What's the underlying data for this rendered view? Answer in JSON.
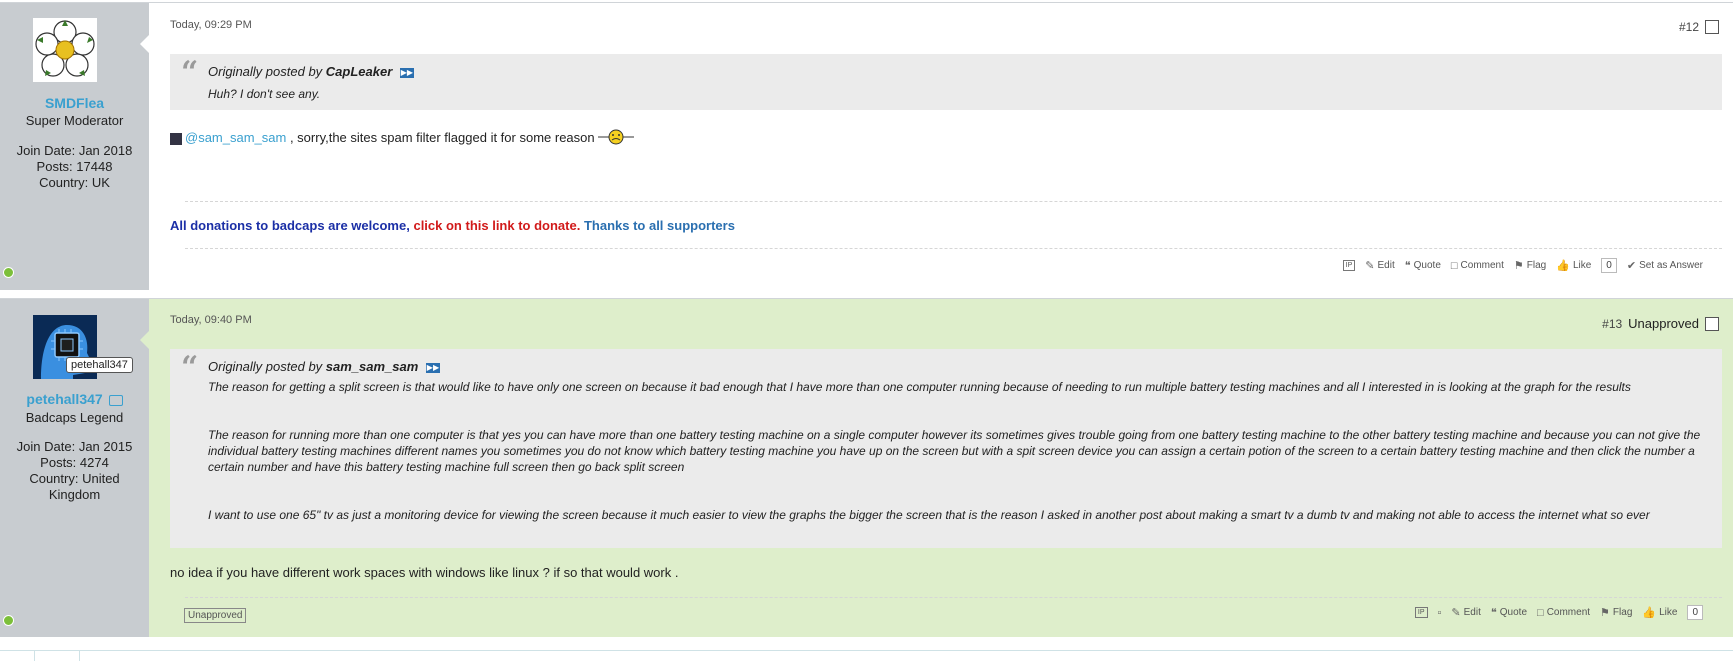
{
  "posts": [
    {
      "user": {
        "name": "SMDFlea",
        "title": "Super Moderator",
        "join_date": "Join Date: Jan 2018",
        "posts": "Posts: 17448",
        "country": "Country: UK"
      },
      "date": "Today, 09:29 PM",
      "number": "#12",
      "quote": {
        "prefix": "Originally posted by",
        "author": "CapLeaker",
        "text": "Huh? I don't see any."
      },
      "mention": "@sam_sam_sam",
      "message": " , sorry,the sites spam filter flagged it for some reason",
      "signature": {
        "part1": "All donations to badcaps are welcome,",
        "part2": "click on this link to donate.",
        "part3": "Thanks to all supporters"
      },
      "actions": {
        "ip": "IP",
        "edit": "Edit",
        "quote": "Quote",
        "comment": "Comment",
        "flag": "Flag",
        "like": "Like",
        "like_count": "0",
        "set_answer": "Set as Answer"
      }
    },
    {
      "user": {
        "name": "petehall347",
        "title": "Badcaps Legend",
        "join_date": "Join Date: Jan 2015",
        "posts": "Posts: 4274",
        "country_line1": "Country: United",
        "country_line2": "Kingdom",
        "tooltip": "petehall347"
      },
      "date": "Today, 09:40 PM",
      "number": "#13",
      "status": "Unapproved",
      "quote": {
        "prefix": "Originally posted by",
        "author": "sam_sam_sam",
        "p1": "The reason for getting a split screen is that would like to have only one screen on because it bad enough that I have more than one computer running because of needing to run multiple battery testing machines and all I interested in is looking at the graph for the results",
        "p2": "The reason for running more than one computer is that yes you can have more than one battery testing machine on a single computer however its sometimes gives trouble going from one battery testing machine to the other battery testing machine and because you can not give the individual battery testing machines different names you sometimes you do not know which battery testing machine you have up on the screen but with a spit screen device you can assign a certain potion of the screen to a certain battery testing machine and then click the number a certain number and have this battery testing machine full screen then go back split screen",
        "p3": "I want to use one 65\" tv as just a monitoring device for viewing the screen because it much easier to view the graphs the bigger the screen that is the reason I asked in another post about making a smart tv a dumb tv and making not able to access the internet what so ever"
      },
      "message": "no idea if you have different work spaces with windows like linux ? if so that would work .",
      "badge": "Unapproved",
      "actions": {
        "ip": "IP",
        "edit": "Edit",
        "quote": "Quote",
        "comment": "Comment",
        "flag": "Flag",
        "like": "Like",
        "like_count": "0"
      }
    }
  ]
}
